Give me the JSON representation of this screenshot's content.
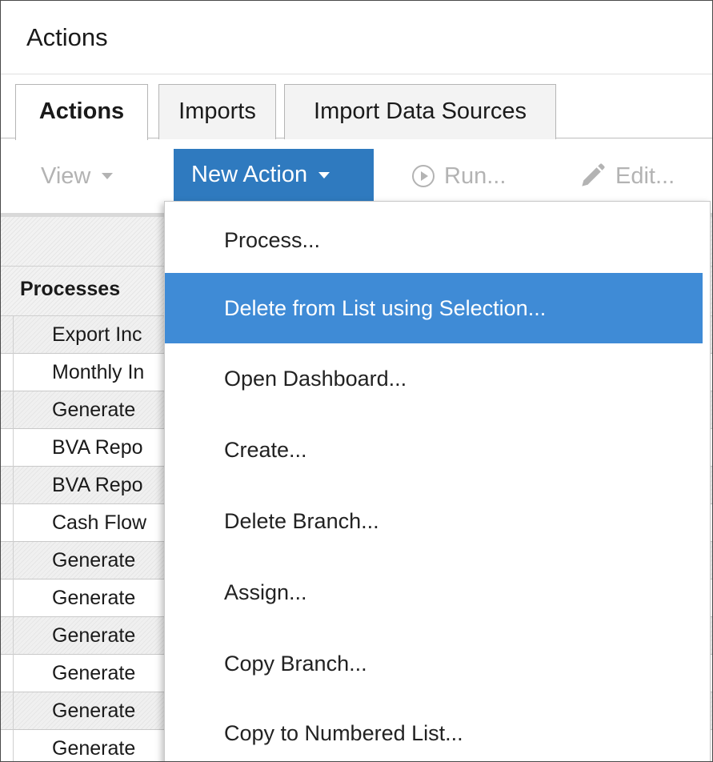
{
  "window": {
    "title": "Actions"
  },
  "tabs": [
    {
      "label": "Actions",
      "active": true
    },
    {
      "label": "Imports",
      "active": false
    },
    {
      "label": "Import Data Sources",
      "active": false
    }
  ],
  "toolbar": {
    "view_label": "View",
    "new_action_label": "New Action",
    "run_label": "Run...",
    "edit_label": "Edit..."
  },
  "table": {
    "column_header": "Processes",
    "rows": [
      "Export Inc",
      "Monthly In",
      "Generate",
      "BVA Repo",
      "BVA Repo",
      "Cash Flow",
      "Generate",
      "Generate",
      "Generate",
      "Generate",
      "Generate",
      "Generate"
    ]
  },
  "menu": {
    "items": [
      {
        "label": "Process...",
        "selected": false
      },
      {
        "label": "Delete from List using Selection...",
        "selected": true
      },
      {
        "label": "Open Dashboard...",
        "selected": false
      },
      {
        "label": "Create...",
        "selected": false
      },
      {
        "label": "Delete Branch...",
        "selected": false
      },
      {
        "label": "Assign...",
        "selected": false
      },
      {
        "label": "Copy Branch...",
        "selected": false
      },
      {
        "label": "Copy to Numbered List...",
        "selected": false
      }
    ]
  },
  "colors": {
    "accent_button": "#2f7abf",
    "menu_highlight": "#3f8bd6",
    "disabled_text": "#b3b3b3"
  }
}
